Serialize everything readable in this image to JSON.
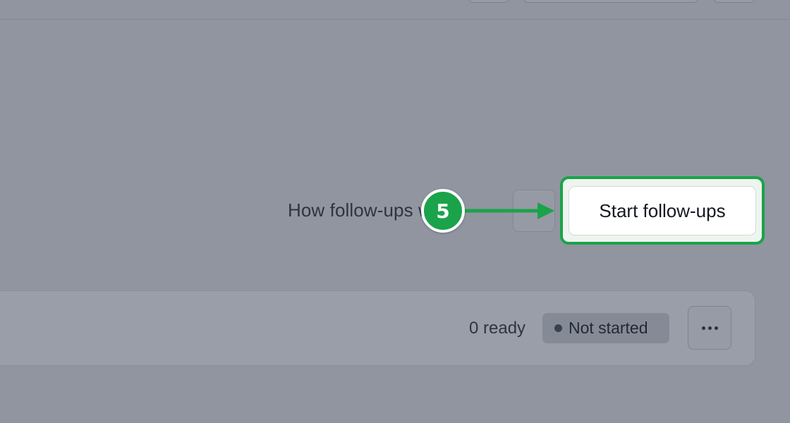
{
  "header": {
    "buttons": 3
  },
  "followups": {
    "how_link": "How follow-ups work",
    "start_label": "Start follow-ups"
  },
  "tutorial": {
    "step_number": "5",
    "accent_color": "#1aa34a"
  },
  "card": {
    "ready_text": "0 ready",
    "status_label": "Not started",
    "more_icon": "more-horizontal-icon"
  }
}
